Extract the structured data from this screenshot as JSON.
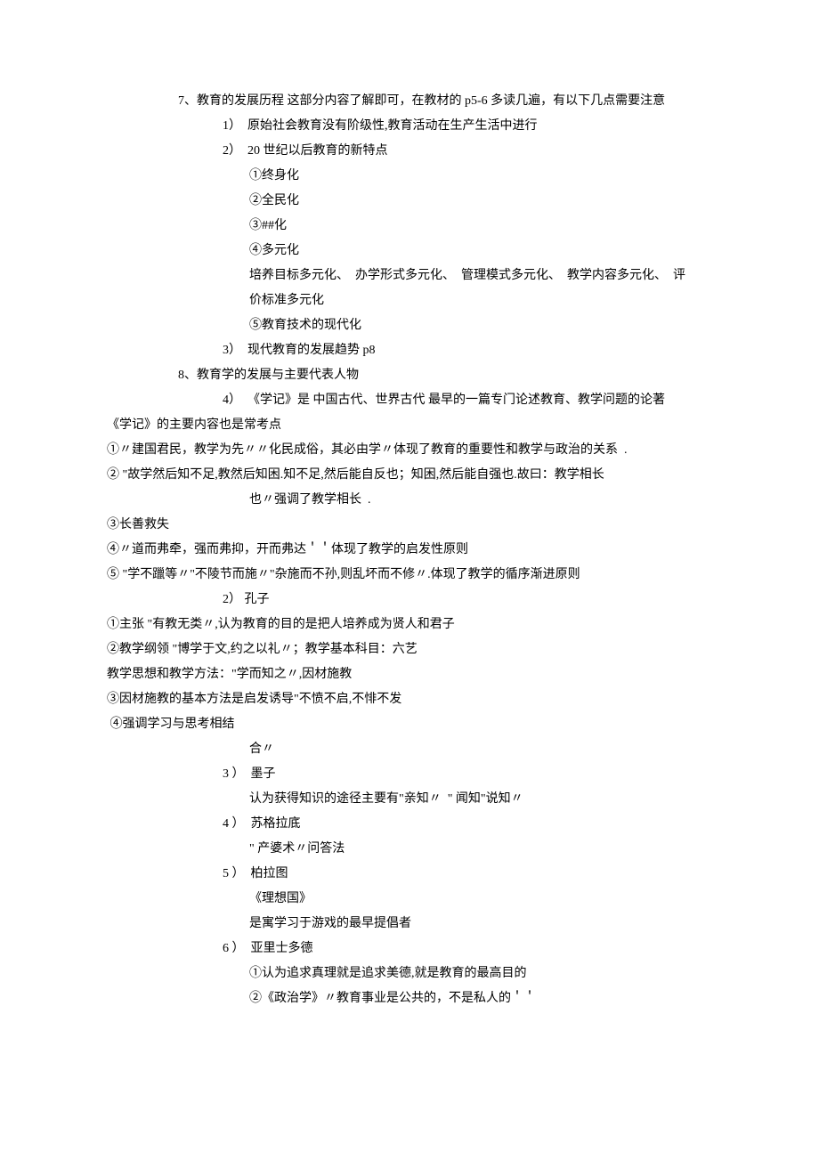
{
  "lines": [
    {
      "cls": "indent-1",
      "text": "7、教育的发展历程 这部分内容了解即可，在教材的 p5-6 多读几遍，有以下几点需要注意"
    },
    {
      "cls": "indent-2",
      "text": "1）  原始社会教育没有阶级性,教育活动在生产生活中进行"
    },
    {
      "cls": "indent-2",
      "text": "2）  20 世纪以后教育的新特点"
    },
    {
      "cls": "indent-3",
      "text": "①终身化"
    },
    {
      "cls": "indent-3",
      "text": "②全民化"
    },
    {
      "cls": "indent-3",
      "text": "③##化"
    },
    {
      "cls": "indent-3",
      "text": "④多元化"
    },
    {
      "cls": "indent-3",
      "text": "培养目标多元化、  办学形式多元化、  管理模式多元化、  教学内容多元化、  评"
    },
    {
      "cls": "indent-3",
      "text": "价标准多元化"
    },
    {
      "cls": "indent-3",
      "text": "⑤教育技术的现代化"
    },
    {
      "cls": "indent-2",
      "text": "3）  现代教育的发展趋势 p8"
    },
    {
      "cls": "indent-1",
      "text": "8、教育学的发展与主要代表人物"
    },
    {
      "cls": "indent-2",
      "text": "4）  《学记》是 中国古代、世界古代 最早的一篇专门论述教育、教学问题的论著"
    },
    {
      "cls": "indent-0",
      "text": "《学记》的主要内容也是常考点"
    },
    {
      "cls": "indent-0",
      "text": "①〃建国君民，教学为先〃〃化民成俗，其必由学〃体现了教育的重要性和教学与政治的关系  ."
    },
    {
      "cls": "indent-0",
      "text": "② \"故学然后知不足,教然后知困.知不足,然后能自反也；知困,然后能自强也.故曰：教学相长"
    },
    {
      "cls": "indent-3",
      "text": "也〃强调了教学相长  ."
    },
    {
      "cls": "indent-0",
      "text": "③长善救失"
    },
    {
      "cls": "indent-0",
      "text": "④〃道而弗牵，强而弗抑，开而弗达＇＇体现了教学的启发性原则"
    },
    {
      "cls": "indent-0",
      "text": "⑤ \"学不躐等〃\"不陵节而施〃\"杂施而不孙,则乱坏而不修〃.体现了教学的循序渐进原则"
    },
    {
      "cls": "indent-sub2",
      "text": "2） 孔子"
    },
    {
      "cls": "indent-0",
      "text": "①主张 \"有教无类〃,认为教育的目的是把人培养成为贤人和君子"
    },
    {
      "cls": "indent-0",
      "text": "②教学纲领 \"博学于文,约之以礼〃；教学基本科目：六艺"
    },
    {
      "cls": "indent-0",
      "text": "教学思想和教学方法：\"学而知之〃,因材施教"
    },
    {
      "cls": "indent-0",
      "text": "③因材施教的基本方法是启发诱导\"不愤不启,不悱不发"
    },
    {
      "cls": "indent-0",
      "text": " ④强调学习与思考相结"
    },
    {
      "cls": "indent-3",
      "text": "合〃"
    },
    {
      "cls": "indent-sub2",
      "text": "3 ）  墨子"
    },
    {
      "cls": "indent-3",
      "text": "认为获得知识的途径主要有\"亲知〃  \" 闻知\"说知〃"
    },
    {
      "cls": "indent-sub2",
      "text": "4 ）  苏格拉底"
    },
    {
      "cls": "indent-3",
      "text": "\" 产婆术〃问答法"
    },
    {
      "cls": "indent-sub2",
      "text": "5 ）  柏拉图"
    },
    {
      "cls": "indent-3",
      "text": "《理想国》"
    },
    {
      "cls": "indent-3",
      "text": "是寓学习于游戏的最早提倡者"
    },
    {
      "cls": "indent-sub2",
      "text": "6 ）  亚里士多德"
    },
    {
      "cls": "indent-3",
      "text": "①认为追求真理就是追求美德,就是教育的最高目的"
    },
    {
      "cls": "indent-3",
      "text": "②《政治学》〃教育事业是公共的，不是私人的＇＇"
    }
  ]
}
